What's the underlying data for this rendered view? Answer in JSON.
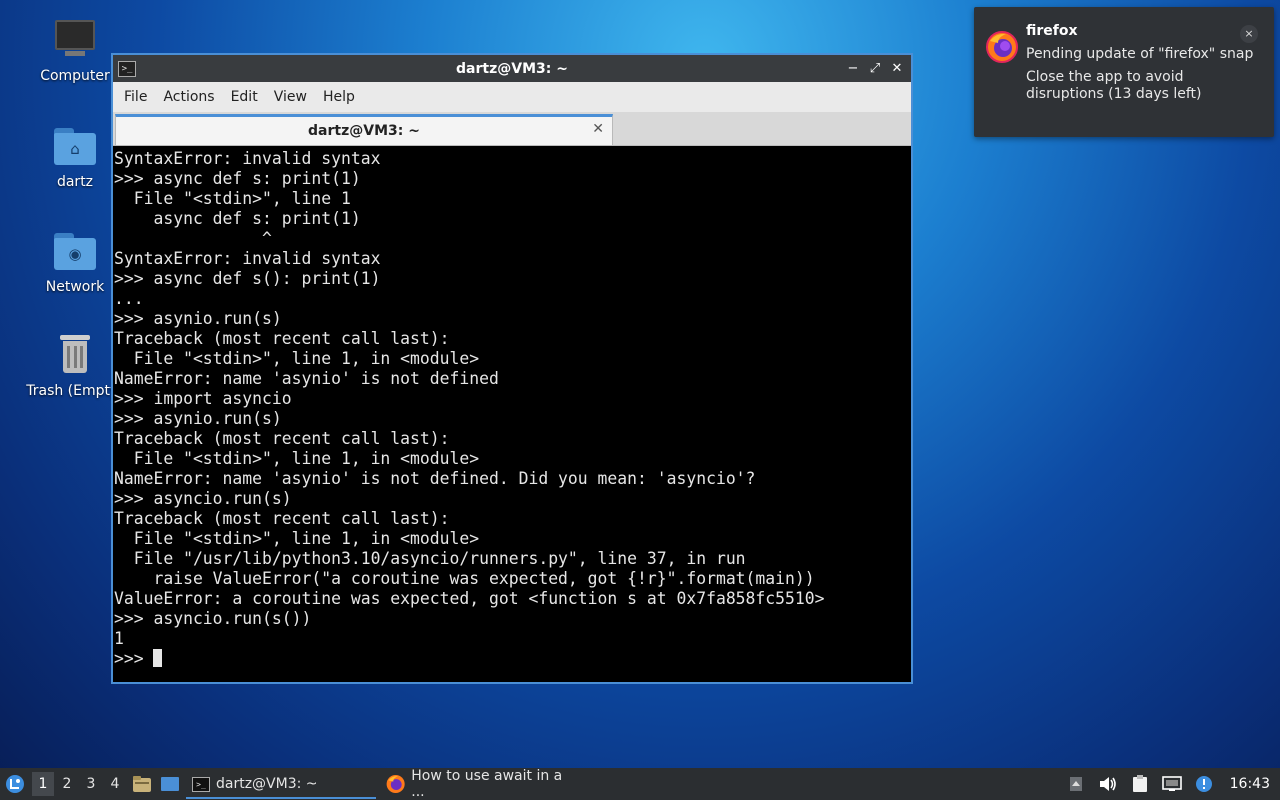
{
  "desktop": {
    "icons": [
      {
        "label": "Computer"
      },
      {
        "label": "dartz"
      },
      {
        "label": "Network"
      },
      {
        "label": "Trash (Empty)"
      }
    ]
  },
  "window": {
    "title": "dartz@VM3: ~",
    "menu": [
      "File",
      "Actions",
      "Edit",
      "View",
      "Help"
    ],
    "tab_label": "dartz@VM3: ~",
    "controls": {
      "minimize": "−",
      "maximize": "⤢",
      "close": "✕"
    }
  },
  "terminal": {
    "lines": [
      "SyntaxError: invalid syntax",
      ">>> async def s: print(1)",
      "  File \"<stdin>\", line 1",
      "    async def s: print(1)",
      "               ^",
      "SyntaxError: invalid syntax",
      ">>> async def s(): print(1)",
      "...",
      ">>> asynio.run(s)",
      "Traceback (most recent call last):",
      "  File \"<stdin>\", line 1, in <module>",
      "NameError: name 'asynio' is not defined",
      ">>> import asyncio",
      ">>> asynio.run(s)",
      "Traceback (most recent call last):",
      "  File \"<stdin>\", line 1, in <module>",
      "NameError: name 'asynio' is not defined. Did you mean: 'asyncio'?",
      ">>> asyncio.run(s)",
      "Traceback (most recent call last):",
      "  File \"<stdin>\", line 1, in <module>",
      "  File \"/usr/lib/python3.10/asyncio/runners.py\", line 37, in run",
      "    raise ValueError(\"a coroutine was expected, got {!r}\".format(main))",
      "ValueError: a coroutine was expected, got <function s at 0x7fa858fc5510>",
      ">>> asyncio.run(s())",
      "1"
    ],
    "prompt": ">>> "
  },
  "notification": {
    "title": "firefox",
    "line1": "Pending update of \"firefox\" snap",
    "line2": "Close the app to avoid disruptions (13 days left)",
    "close": "×"
  },
  "taskbar": {
    "workspaces": [
      "1",
      "2",
      "3",
      "4"
    ],
    "tasks": [
      {
        "label": "dartz@VM3: ~"
      },
      {
        "label": "How to use await in a ..."
      }
    ],
    "clock": "16:43"
  },
  "colors": {
    "accent": "#4a8fd6",
    "terminal_bg": "#000000",
    "terminal_fg": "#e6e6e6",
    "panel_bg": "#2b2e31"
  }
}
